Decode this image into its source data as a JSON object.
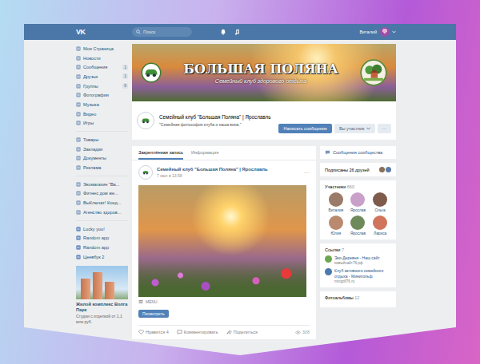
{
  "header": {
    "logo": "VK",
    "search": "Поиск",
    "user": "Виталий"
  },
  "sidebar": {
    "sections": [
      {
        "items": [
          {
            "label": "Моя Страница"
          },
          {
            "label": "Новости"
          },
          {
            "label": "Сообщения",
            "badge": "1"
          },
          {
            "label": "Друзья",
            "badge": "1"
          },
          {
            "label": "Группы",
            "badge": "6"
          },
          {
            "label": "Фотографии"
          },
          {
            "label": "Музыка"
          },
          {
            "label": "Видео"
          },
          {
            "label": "Игры"
          }
        ]
      },
      {
        "items": [
          {
            "label": "Товары"
          },
          {
            "label": "Закладки"
          },
          {
            "label": "Документы"
          },
          {
            "label": "Реклама"
          }
        ]
      },
      {
        "items": [
          {
            "label": "Экомагазин \"Ва..."
          },
          {
            "label": "Фитнес дом же..."
          },
          {
            "label": "ВыКлючат! Конд..."
          },
          {
            "label": "Агенство здоров..."
          }
        ]
      },
      {
        "items": [
          {
            "label": "Lucky you!"
          },
          {
            "label": "Random app"
          },
          {
            "label": "Random app"
          },
          {
            "label": "Цеевбук 2"
          }
        ]
      }
    ]
  },
  "ad": {
    "title": "Жилой комплекс Волга Парк",
    "text": "Студии с отделкой от 1,1 млн руб."
  },
  "cover": {
    "title": "БОЛЬШАЯ ПОЛЯНА",
    "subtitle": "Семейный клуб здорового отдыха"
  },
  "group": {
    "name": "Семейный клуб \"Большая Поляна\" | Ярославль",
    "status": "\"Семейная философия клуба и наша вина.\"",
    "message_button": "Написать сообщение",
    "member_button": "Вы участник",
    "more": "···"
  },
  "tabs": [
    {
      "label": "Закреплённая запись",
      "selected": true
    },
    {
      "label": "Информация",
      "selected": false
    }
  ],
  "post": {
    "author": "Семейный клуб \"Большая Поляна\" | Ярославль",
    "date": "7 июл в 13:58",
    "more": "···",
    "menu_label": "MENU",
    "view_button": "Посмотреть",
    "likes_label": "Нравится",
    "likes_count": "4",
    "comment": "Комментировать",
    "share": "Поделиться",
    "views": "308"
  },
  "right": {
    "messages": "Сообщения сообщества",
    "friends": "Подписаны 26 друзей",
    "members": {
      "title": "Участники",
      "count": "660",
      "people": [
        "Виталия",
        "Ярослав",
        "Ольга",
        "Юлия",
        "Ярослав",
        "Лариса"
      ]
    },
    "links": {
      "title": "Ссылки",
      "count": "7",
      "items": [
        {
          "title": "Эко-Деревня - Наш сайт",
          "url": "новыйсайт76.рф"
        },
        {
          "title": "Клуб активного семейного отдыха - Минигольф",
          "url": "mingolf76.ru"
        }
      ]
    },
    "albums": {
      "title": "Фотоальбомы",
      "count": "12"
    }
  }
}
